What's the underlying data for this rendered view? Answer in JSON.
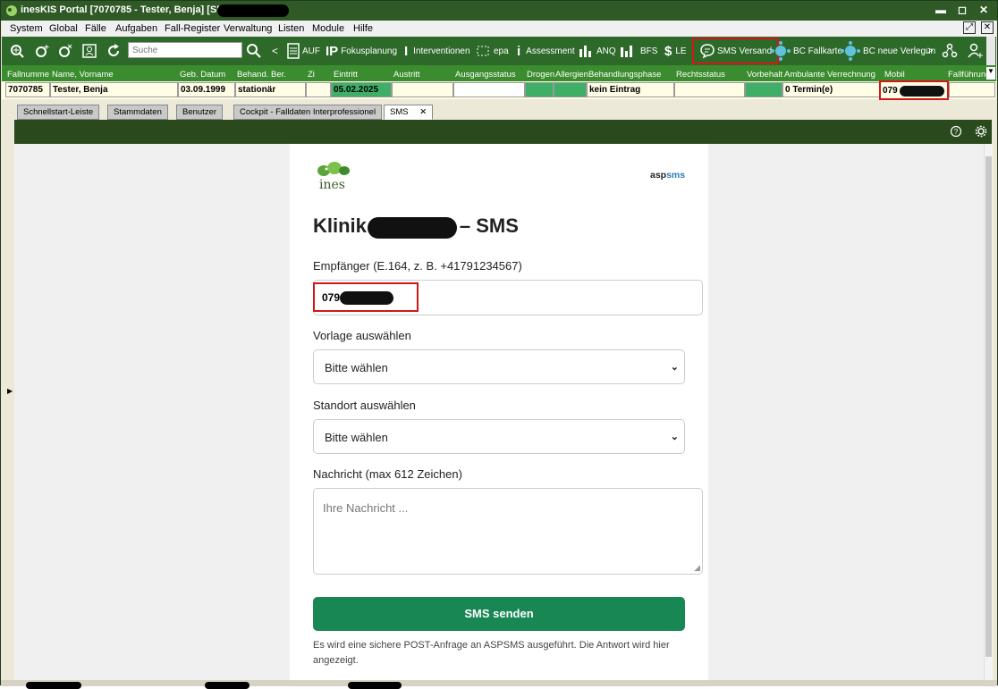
{
  "window": {
    "title": "inesKIS Portal  [7070785 - Tester, Benja]  [SMS] [a"
  },
  "menu": [
    "System",
    "Global",
    "Fälle",
    "Aufgaben",
    "Fall-Register",
    "Verwaltung",
    "Listen",
    "Module",
    "Hilfe"
  ],
  "toolbar": {
    "search_placeholder": "Suche",
    "back_label": "<",
    "auf": "AUF",
    "fokusplanung": "Fokusplanung",
    "interventionen": "Interventionen",
    "epa": "epa",
    "assessment": "Assessment",
    "anq": "ANQ",
    "bfs": "BFS",
    "le": "LE",
    "sms_versand": "SMS Versand",
    "bc_fallkarte": "BC Fallkarte",
    "bc_neue_verlegung": "BC neue Verlegun",
    "more": ">"
  },
  "patient": {
    "headers": [
      "Fallnumme",
      "Name, Vorname",
      "Geb. Datum",
      "Behand. Ber.",
      "Zi",
      "Eintritt",
      "Austritt",
      "Ausgangsstatus",
      "Drogen",
      "Allergien",
      "Behandlungsphase",
      "Rechtsstatus",
      "Vorbehalt",
      "Ambulante Verrechnung",
      "Mobil",
      "Fallführung"
    ],
    "fallnummer": "7070785",
    "name": "Tester, Benja",
    "geb_datum": "03.09.1999",
    "behand_ber": "stationär",
    "eintritt": "05.02.2025",
    "behandlungsphase": "kein Eintrag",
    "ambulante_verrechnung": "0 Termin(e)",
    "mobil": "079"
  },
  "tabs": [
    "Schnellstart-Leiste",
    "Stammdaten",
    "Benutzer",
    "Cockpit - Falldaten Interprofessionel",
    "SMS"
  ],
  "tab_close": "✕",
  "form": {
    "logo_text": "ines",
    "brand_asp": "asp",
    "brand_sms": "sms",
    "title_start": "Klinik",
    "title_end": "– SMS",
    "recipient_label": "Empfänger (E.164, z. B. +41791234567)",
    "recipient_value": "079",
    "template_label": "Vorlage auswählen",
    "template_value": "Bitte wählen",
    "location_label": "Standort auswählen",
    "location_value": "Bitte wählen",
    "message_label": "Nachricht (max 612 Zeichen)",
    "message_placeholder": "Ihre Nachricht ...",
    "send_button": "SMS senden",
    "note": "Es wird eine sichere POST-Anfrage an ASPSMS ausgeführt. Die Antwort wird hier angezeigt."
  }
}
